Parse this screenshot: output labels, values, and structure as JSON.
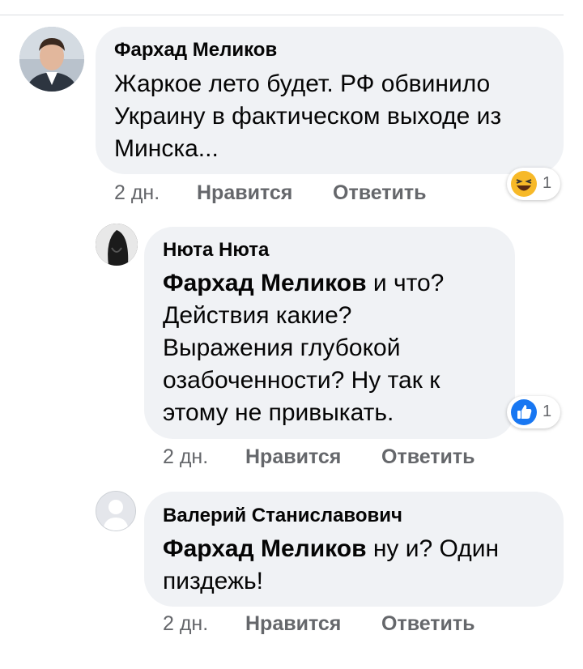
{
  "comments": [
    {
      "author": "Фархад Меликов",
      "text_lines": [
        "Жаркое лето будет. РФ обвинило",
        "Украину в фактическом выходе из",
        "Минска..."
      ],
      "time": "2 дн.",
      "like_label": "Нравится",
      "reply_label": "Ответить",
      "reaction": {
        "icon": "haha-emoji-icon",
        "count": "1",
        "color": "#f7b928"
      }
    },
    {
      "author": "Нюта Нюта",
      "mention": "Фархад Меликов",
      "text_lines": [
        " и что?",
        "Действия какие?",
        "Выражения глубокой",
        "озабоченности? Ну так к",
        "этому не привыкать."
      ],
      "time": "2 дн.",
      "like_label": "Нравится",
      "reply_label": "Ответить",
      "reaction": {
        "icon": "like-thumb-icon",
        "count": "1",
        "color": "#1877f2"
      }
    },
    {
      "author": "Валерий Станиславович",
      "mention": "Фархад Меликов",
      "text_lines": [
        " ну и? Один",
        "пиздежь!"
      ],
      "time": "2 дн.",
      "like_label": "Нравится",
      "reply_label": "Ответить"
    }
  ]
}
